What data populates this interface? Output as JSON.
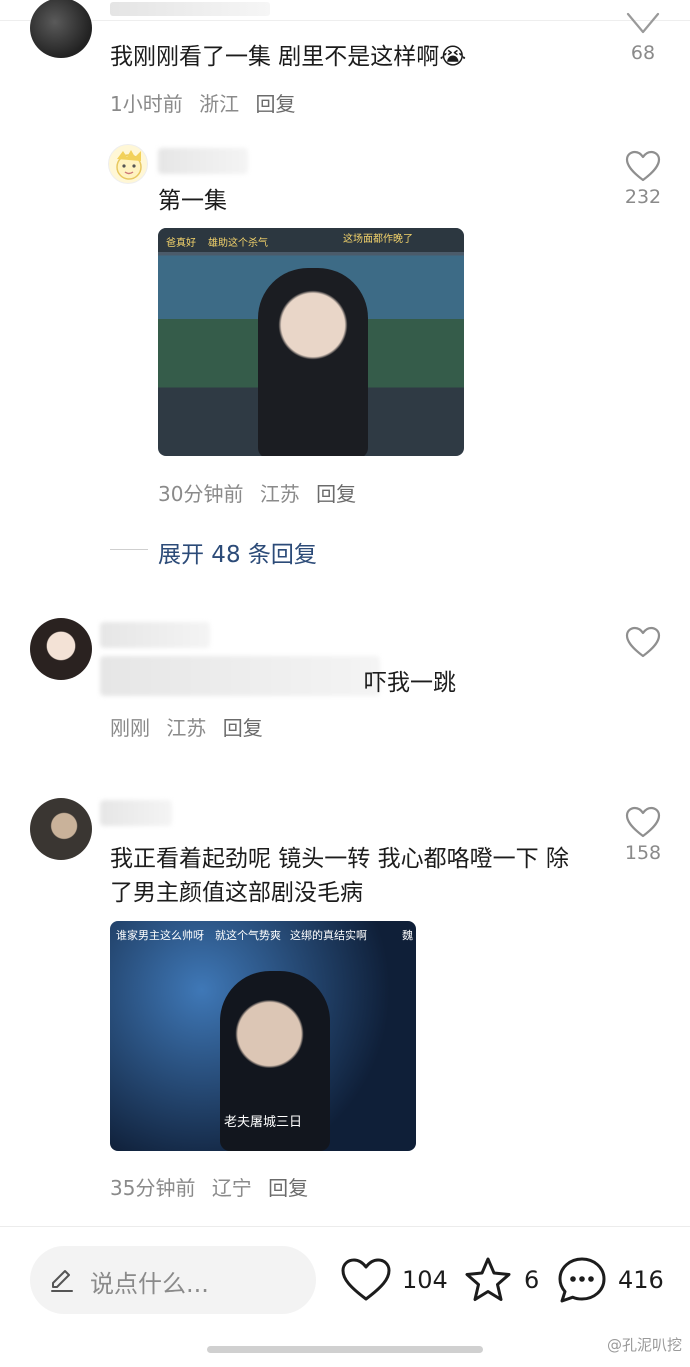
{
  "comments": [
    {
      "text": "我刚刚看了一集 剧里不是这样啊",
      "emoji": "😭",
      "meta": {
        "time": "1小时前",
        "location": "浙江",
        "reply": "回复"
      },
      "likes": "68"
    },
    {
      "text": "第一集",
      "meta": {
        "time": "30分钟前",
        "location": "江苏",
        "reply": "回复"
      },
      "likes": "232",
      "image_captions": [
        "爸真好",
        "雄助这个杀气",
        "这场面都作晚了"
      ]
    },
    {
      "text": "吓我一跳",
      "meta": {
        "time": "刚刚",
        "location": "江苏",
        "reply": "回复"
      }
    },
    {
      "text": "我正看着起劲呢 镜头一转 我心都咯噔一下 除了男主颜值这部剧没毛病",
      "meta": {
        "time": "35分钟前",
        "location": "辽宁",
        "reply": "回复"
      },
      "likes": "158",
      "image_captions": [
        "谁家男主这么帅呀",
        "就这个气势爽",
        "这绑的真结实啊",
        "魏"
      ],
      "image_subtitle": "老夫屠城三日"
    }
  ],
  "expand_replies": "展开 48 条回复",
  "bottom_bar": {
    "input_placeholder": "说点什么...",
    "like_count": "104",
    "favorite_count": "6",
    "comment_count": "416"
  },
  "watermark": "@孔泥叭挖"
}
